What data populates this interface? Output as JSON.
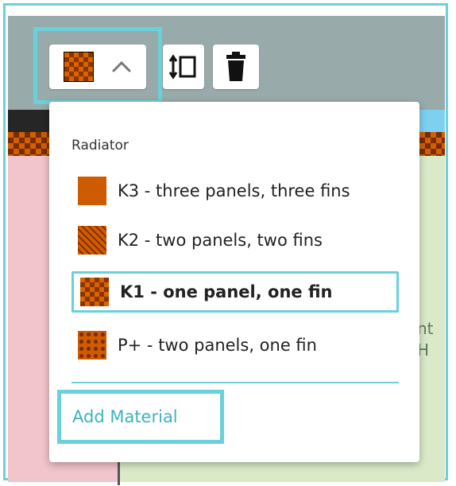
{
  "canvas": {
    "partial_text": [
      "nt",
      "H"
    ]
  },
  "toolbar": {
    "material_button_icon": "material-swatch-k1",
    "chevron_icon": "chevron-up-icon",
    "resize_icon": "vertical-resize-icon",
    "delete_icon": "trash-icon"
  },
  "dropdown": {
    "heading": "Radiator",
    "items": [
      {
        "label": "K3 - three panels, three fins",
        "pattern": "solid"
      },
      {
        "label": "K2 - two panels, two fins",
        "pattern": "diagonal-stripes"
      },
      {
        "label": "K1 - one panel, one fin",
        "pattern": "checker",
        "selected": true
      },
      {
        "label": "P+ - two panels, one fin",
        "pattern": "dots"
      }
    ],
    "add_label": "Add Material"
  },
  "colors": {
    "accent": "#6ad1da",
    "material": "#cf5b00"
  }
}
